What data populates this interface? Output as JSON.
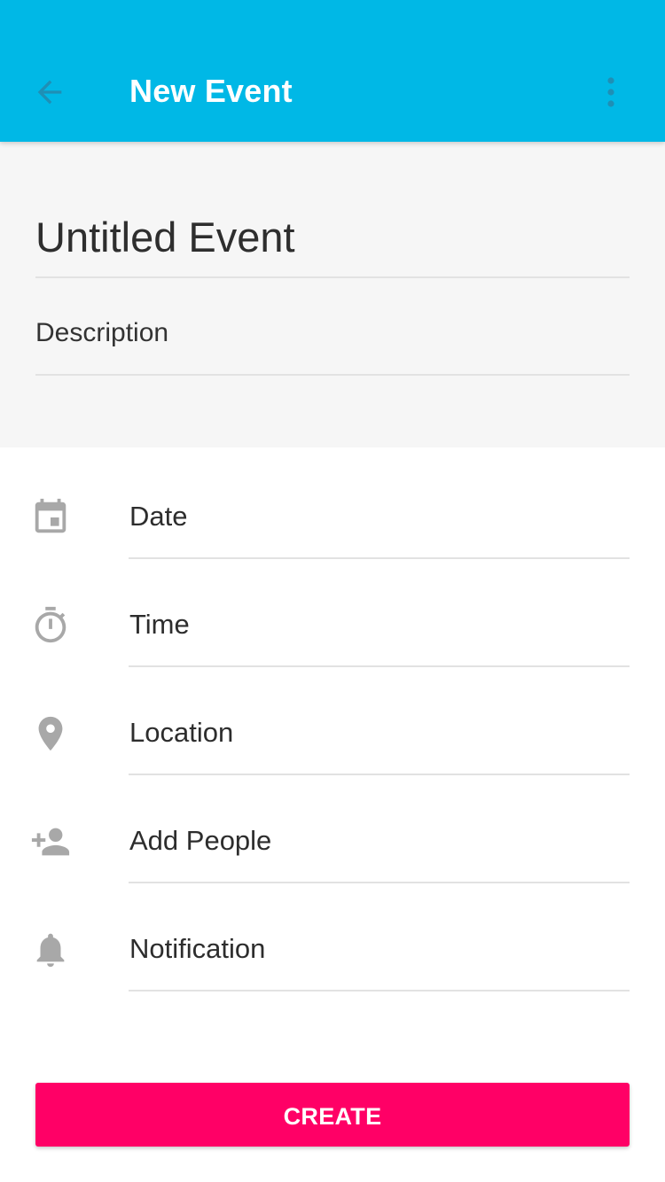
{
  "colors": {
    "appbar": "#00b8e6",
    "accent_button": "#ff0066",
    "icon_gray": "#a8a8a8",
    "header_bg": "#f6f6f6"
  },
  "appbar": {
    "back_icon": "arrow-back-icon",
    "title": "New Event",
    "menu_icon": "more-vertical-icon"
  },
  "event": {
    "title": "Untitled Event",
    "description_label": "Description"
  },
  "fields": [
    {
      "label": "Date",
      "icon": "calendar-icon"
    },
    {
      "label": "Time",
      "icon": "timer-icon"
    },
    {
      "label": "Location",
      "icon": "location-pin-icon"
    },
    {
      "label": "Add People",
      "icon": "add-person-icon"
    },
    {
      "label": "Notification",
      "icon": "bell-icon"
    }
  ],
  "actions": {
    "create_label": "CREATE"
  }
}
